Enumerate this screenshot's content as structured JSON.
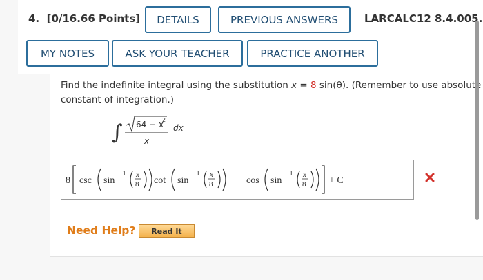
{
  "header": {
    "question_number": "4.",
    "points": "[0/16.66 Points]",
    "details": "DETAILS",
    "previous_answers": "PREVIOUS ANSWERS",
    "problem_code": "LARCALC12 8.4.005.",
    "my_notes": "MY NOTES",
    "ask_teacher": "ASK YOUR TEACHER",
    "practice_another": "PRACTICE ANOTHER"
  },
  "question": {
    "text_line1_a": "Find the indefinite integral using the substitution",
    "sub_var": "x",
    "sub_equals": "=",
    "sub_coef": "8",
    "sub_func": "sin(θ).",
    "text_line1_b": "(Remember to use absolute va",
    "text_line2": "constant of integration.)",
    "integrand_numerator": "64 − x",
    "integrand_exponent": "2",
    "integrand_denominator": "x",
    "differential": "dx"
  },
  "answer": {
    "coef": "8",
    "csc": "csc",
    "sin": "sin",
    "inv_exp": "−1",
    "frac_num": "x",
    "frac_den": "8",
    "cot": "cot",
    "minus": "−",
    "cos": "cos",
    "plus_c": "+ C",
    "status": "incorrect"
  },
  "help": {
    "label": "Need Help?",
    "read_it": "Read It"
  },
  "colors": {
    "button_border": "#2c6e9c",
    "highlight_red": "#d2312b",
    "need_help_orange": "#e07d1a"
  }
}
